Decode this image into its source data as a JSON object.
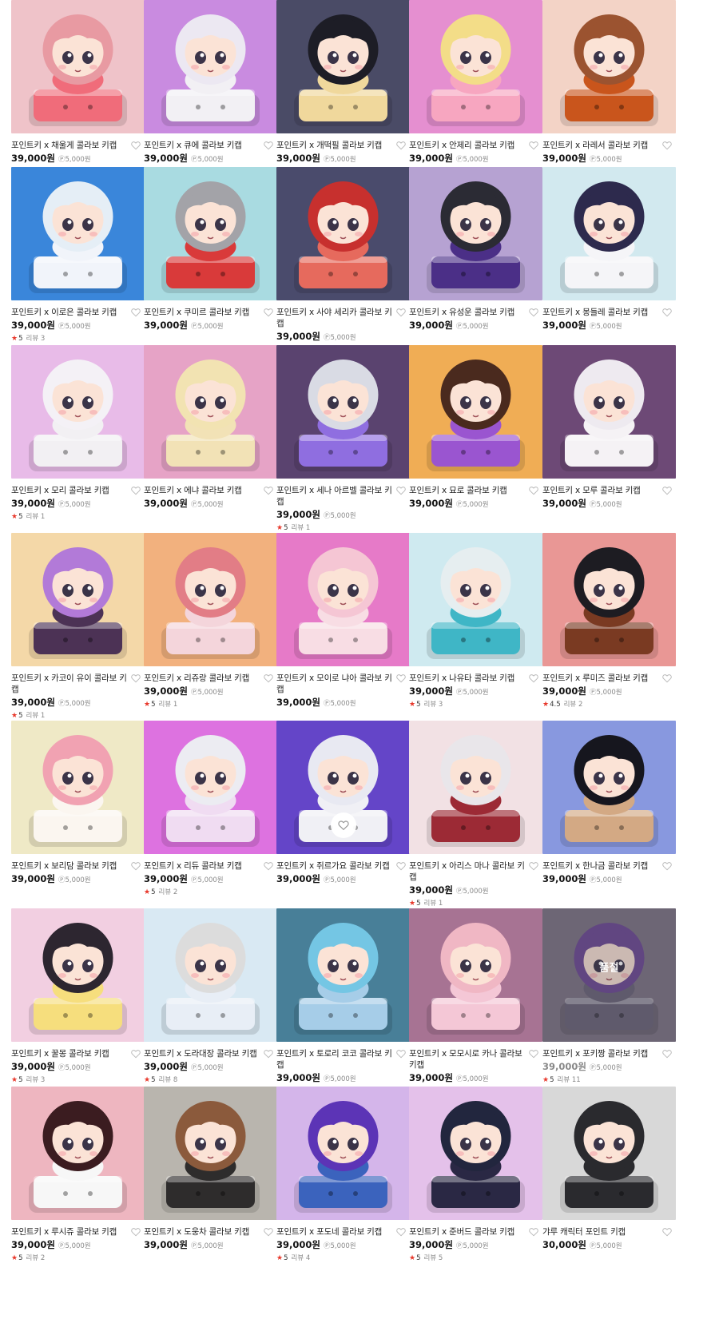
{
  "currency_suffix": "원",
  "point_prefix": "Ⓟ",
  "products": [
    {
      "name": "포인트키 x 채울게 콜라보 키캡",
      "price": "39,000원",
      "point": "Ⓟ5,000원",
      "bg": "#efc3c9",
      "hair": "#e89aa2",
      "base": "#f06c7a"
    },
    {
      "name": "포인트키 x 큐에 콜라보 키캡",
      "price": "39,000원",
      "point": "Ⓟ5,000원",
      "bg": "#c98be0",
      "hair": "#ece8f2",
      "base": "#f2f0f4"
    },
    {
      "name": "포인트키 x 개떡필 콜라보 키캡",
      "price": "39,000원",
      "point": "Ⓟ5,000원",
      "bg": "#4a4b66",
      "hair": "#1d1d26",
      "base": "#f0d89c"
    },
    {
      "name": "포인트키 x 안제리 콜라보 키캡",
      "price": "39,000원",
      "point": "Ⓟ5,000원",
      "bg": "#e58fd0",
      "hair": "#f3dd88",
      "base": "#f7a6c0"
    },
    {
      "name": "포인트키 x 라레서 콜라보 키캡",
      "price": "39,000원",
      "point": "Ⓟ5,000원",
      "bg": "#f3d3c6",
      "hair": "#9b5330",
      "base": "#c9551c"
    },
    {
      "name": "포인트키 x 이로은 콜라보 키캡",
      "price": "39,000원",
      "point": "Ⓟ5,000원",
      "rating": "5",
      "reviews": "리뷰 3",
      "bg": "#3a86da",
      "hair": "#e5eef6",
      "base": "#f1f4fa"
    },
    {
      "name": "포인트키 x 쿠미르 콜라보 키캡",
      "price": "39,000원",
      "point": "Ⓟ5,000원",
      "bg": "#a9dbe1",
      "hair": "#a3a3a8",
      "base": "#d93a3a"
    },
    {
      "name": "포인트키 x 사야 세리카 콜라보 키캡",
      "price": "39,000원",
      "point": "Ⓟ5,000원",
      "bg": "#4a4b6c",
      "hair": "#c7302e",
      "base": "#e66a5d"
    },
    {
      "name": "포인트키 x 유성운 콜라보 키캡",
      "price": "39,000원",
      "point": "Ⓟ5,000원",
      "bg": "#b6a2d2",
      "hair": "#2b2b34",
      "base": "#4b2f87"
    },
    {
      "name": "포인트키 x 몽들레 콜라보 키캡",
      "price": "39,000원",
      "point": "Ⓟ5,000원",
      "bg": "#d2e9ef",
      "hair": "#2d2a4d",
      "base": "#f5f5f8"
    },
    {
      "name": "포인트키 x 모리 콜라보 키캡",
      "price": "39,000원",
      "point": "Ⓟ5,000원",
      "rating": "5",
      "reviews": "리뷰 1",
      "bg": "#e8bbe8",
      "hair": "#f4f1f6",
      "base": "#f2f0f3"
    },
    {
      "name": "포인트키 x 에냐 콜라보 키캡",
      "price": "39,000원",
      "point": "Ⓟ5,000원",
      "bg": "#e6a3c6",
      "hair": "#f2e3b2",
      "base": "#f2e2b6"
    },
    {
      "name": "포인트키 x 세나 아르벨 콜라보 키캡",
      "price": "39,000원",
      "point": "Ⓟ5,000원",
      "rating": "5",
      "reviews": "리뷰 1",
      "bg": "#5a436f",
      "hair": "#d9dbe4",
      "base": "#8f6ee0"
    },
    {
      "name": "포인트키 x 묘로 콜라보 키캡",
      "price": "39,000원",
      "point": "Ⓟ5,000원",
      "bg": "#f0ad55",
      "hair": "#4a2a1e",
      "base": "#9a55d0"
    },
    {
      "name": "포인트키 x 모루 콜라보 키캡",
      "price": "39,000원",
      "point": "Ⓟ5,000원",
      "bg": "#6d4976",
      "hair": "#eeeaf0",
      "base": "#f5f2f5"
    },
    {
      "name": "포인트키 x 카코이 유이 콜라보 키캡",
      "price": "39,000원",
      "point": "Ⓟ5,000원",
      "rating": "5",
      "reviews": "리뷰 1",
      "bg": "#f4d8a8",
      "hair": "#b27ad8",
      "base": "#4c3255"
    },
    {
      "name": "포인트키 x 리쥬랑 콜라보 키캡",
      "price": "39,000원",
      "point": "Ⓟ5,000원",
      "rating": "5",
      "reviews": "리뷰 1",
      "bg": "#f2b17e",
      "hair": "#e27d86",
      "base": "#f4d5db"
    },
    {
      "name": "포인트키 x 모이로 냐아 콜라보 키캡",
      "price": "39,000원",
      "point": "Ⓟ5,000원",
      "bg": "#e67ac8",
      "hair": "#f5c6d4",
      "base": "#f8dde4"
    },
    {
      "name": "포인트키 x 나유타 콜라보 키캡",
      "price": "39,000원",
      "point": "Ⓟ5,000원",
      "rating": "5",
      "reviews": "리뷰 3",
      "bg": "#cfeaf0",
      "hair": "#e6eef0",
      "base": "#3fb6c6"
    },
    {
      "name": "포인트키 x 루미즈 콜라보 키캡",
      "price": "39,000원",
      "point": "Ⓟ5,000원",
      "rating": "4.5",
      "reviews": "리뷰 2",
      "bg": "#e99795",
      "hair": "#1d1c22",
      "base": "#7a3a22"
    },
    {
      "name": "포인트키 x 보리담 콜라보 키캡",
      "price": "39,000원",
      "point": "Ⓟ5,000원",
      "bg": "#efe9c6",
      "hair": "#f1a2b2",
      "base": "#fbf6f0"
    },
    {
      "name": "포인트키 x 리듀 콜라보 키캡",
      "price": "39,000원",
      "point": "Ⓟ5,000원",
      "rating": "5",
      "reviews": "리뷰 2",
      "bg": "#dd72e0",
      "hair": "#ececf2",
      "base": "#f0dcf2"
    },
    {
      "name": "포인트키 x 쥐르가요 콜라보 키캡",
      "price": "39,000원",
      "point": "Ⓟ5,000원",
      "bg": "#6445c8",
      "hair": "#e8e9f2",
      "base": "#f0f0f5"
    },
    {
      "name": "포인트키 x 아리스 마나 콜라보 키캡",
      "price": "39,000원",
      "point": "Ⓟ5,000원",
      "rating": "5",
      "reviews": "리뷰 1",
      "bg": "#f2e1e4",
      "hair": "#e9e6ea",
      "base": "#9c2a35"
    },
    {
      "name": "포인트키 x 한나금 콜라보 키캡",
      "price": "39,000원",
      "point": "Ⓟ5,000원",
      "bg": "#8898df",
      "hair": "#16161e",
      "base": "#d3a984"
    },
    {
      "name": "포인트키 x 꿀몽 콜라보 키캡",
      "price": "39,000원",
      "point": "Ⓟ5,000원",
      "rating": "5",
      "reviews": "리뷰 3",
      "bg": "#f2cfe1",
      "hair": "#2d2630",
      "base": "#f6de7d"
    },
    {
      "name": "포인트키 x 도라대장 콜라보 키캡",
      "price": "39,000원",
      "point": "Ⓟ5,000원",
      "rating": "5",
      "reviews": "리뷰 8",
      "bg": "#d9e9f3",
      "hair": "#dcdcdc",
      "base": "#e8eef6"
    },
    {
      "name": "포인트키 x 토로리 코코 콜라보 키캡",
      "price": "39,000원",
      "point": "Ⓟ5,000원",
      "bg": "#487f98",
      "hair": "#74c6e4",
      "base": "#a6cde8"
    },
    {
      "name": "포인트키 x 모모시로 카나 콜라보 키캡",
      "price": "39,000원",
      "point": "Ⓟ5,000원",
      "bg": "#a77393",
      "hair": "#f0b7c4",
      "base": "#f4c7d6"
    },
    {
      "name": "포인트키 x 포키짱 콜라보 키캡",
      "price": "39,000원",
      "point": "Ⓟ5,000원",
      "rating": "5",
      "reviews": "리뷰 11",
      "soldout": "품절",
      "bg": "#7e7585",
      "hair": "#6e4a94",
      "base": "#6b6478"
    },
    {
      "name": "포인트키 x 루시쥬 콜라보 키캡",
      "price": "39,000원",
      "point": "Ⓟ5,000원",
      "rating": "5",
      "reviews": "리뷰 2",
      "bg": "#eeb6c0",
      "hair": "#3b1c20",
      "base": "#f7f7f7"
    },
    {
      "name": "포인트키 x 도웅차 콜라보 키캡",
      "price": "39,000원",
      "point": "Ⓟ5,000원",
      "bg": "#b9b5ae",
      "hair": "#8b5a3c",
      "base": "#2e2c2c"
    },
    {
      "name": "포인트키 x 포도네 콜라보 키캡",
      "price": "39,000원",
      "point": "Ⓟ5,000원",
      "rating": "5",
      "reviews": "리뷰 4",
      "bg": "#d4b5ea",
      "hair": "#5c34b6",
      "base": "#3b63bd"
    },
    {
      "name": "포인트키 x 준버드 콜라보 키캡",
      "price": "39,000원",
      "point": "Ⓟ5,000원",
      "rating": "5",
      "reviews": "리뷰 5",
      "bg": "#e4c1ea",
      "hair": "#22263e",
      "base": "#2a2844"
    },
    {
      "name": "갸루 캐릭터 포인트 키캡",
      "price": "30,000원",
      "point": "Ⓟ5,000원",
      "bg": "#d8d8d8",
      "hair": "#2a2a2e",
      "base": "#2a2a2e"
    }
  ]
}
